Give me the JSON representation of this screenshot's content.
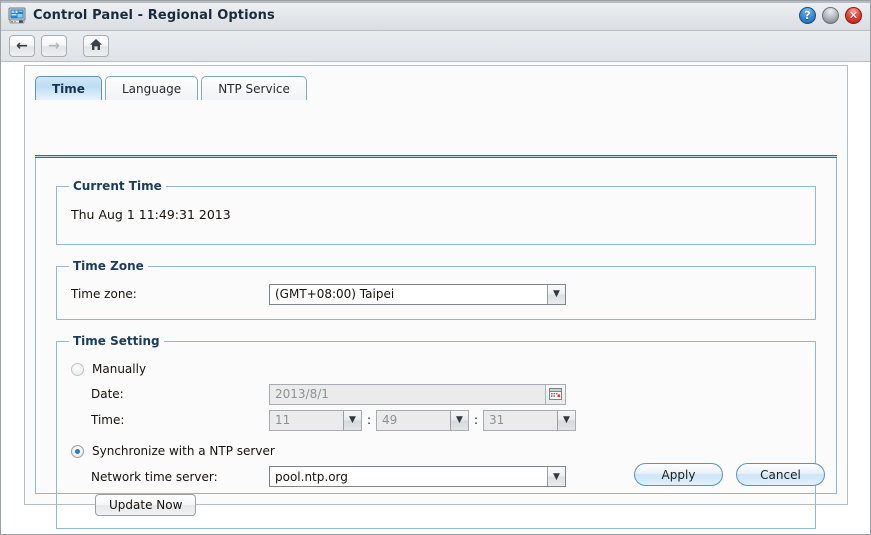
{
  "window": {
    "title": "Control Panel - Regional Options",
    "icon": "control-panel-icon",
    "buttons": {
      "help": "?",
      "minimize": "",
      "close": "✕"
    }
  },
  "toolbar": {
    "back": "←",
    "forward": "→",
    "home": "home-icon"
  },
  "tabs": [
    {
      "label": "Time",
      "active": true
    },
    {
      "label": "Language",
      "active": false
    },
    {
      "label": "NTP Service",
      "active": false
    }
  ],
  "current_time": {
    "legend": "Current Time",
    "value": "Thu Aug 1 11:49:31 2013"
  },
  "time_zone": {
    "legend": "Time Zone",
    "label": "Time zone:",
    "value": "(GMT+08:00) Taipei"
  },
  "time_setting": {
    "legend": "Time Setting",
    "manual": {
      "label": "Manually",
      "selected": false,
      "date_label": "Date:",
      "date_value": "2013/8/1",
      "time_label": "Time:",
      "hour": "11",
      "minute": "49",
      "second": "31",
      "separator": ":"
    },
    "ntp": {
      "label": "Synchronize with a NTP server",
      "selected": true,
      "server_label": "Network time server:",
      "server_value": "pool.ntp.org",
      "update_button": "Update Now"
    }
  },
  "footer": {
    "apply": "Apply",
    "cancel": "Cancel"
  },
  "colors": {
    "accent": "#2a7bc0",
    "group_border": "#8fb8d4",
    "legend_text": "#1b3c5c",
    "titlebar_top": "#eef1f4",
    "close_red": "#e04b3e"
  }
}
